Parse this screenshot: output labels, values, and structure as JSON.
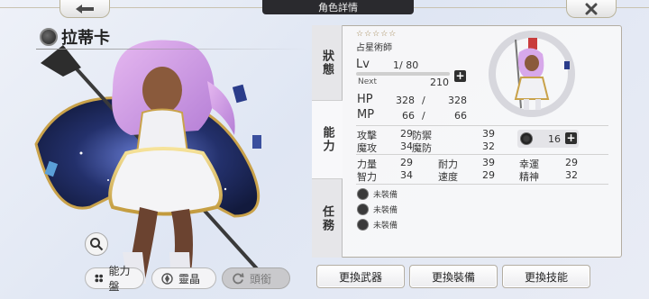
{
  "header": {
    "title": "角色詳情",
    "back_icon": "arrow-left-icon",
    "close_icon": "close-icon"
  },
  "character": {
    "name": "拉蒂卡",
    "element_icon": "dark-element-icon",
    "rarity_stars": "☆☆☆☆☆",
    "job": "占星術師"
  },
  "tabs": {
    "status": "狀態",
    "ability": "能力",
    "mission": "任務"
  },
  "level": {
    "label": "Lv",
    "value": "1/ 80",
    "next_label": "Next",
    "next_value": "210",
    "progress": 0.0
  },
  "vitals": {
    "hp_label": "HP",
    "hp_current": "328",
    "hp_max": "328",
    "mp_label": "MP",
    "mp_current": "66",
    "mp_max": "66",
    "separator": "/"
  },
  "stats": {
    "atk_label": "攻擊",
    "atk": "29",
    "def_label": "防禦",
    "def": "39",
    "matk_label": "魔攻",
    "matk": "34",
    "mdef_label": "魔防",
    "mdef": "32",
    "str_label": "力量",
    "str": "29",
    "vit_label": "耐力",
    "vit": "39",
    "luk_label": "幸運",
    "luk": "29",
    "int_label": "智力",
    "int": "34",
    "spd_label": "速度",
    "spd": "29",
    "spi_label": "精神",
    "spi": "32"
  },
  "gem": {
    "value": "16"
  },
  "equipment": {
    "slot1": "未裝備",
    "slot2": "未裝備",
    "slot3": "未裝備"
  },
  "left_buttons": {
    "ability_board": "能力盤",
    "crystal": "靈晶",
    "title": "頭銜"
  },
  "actions": {
    "change_weapon": "更換武器",
    "change_equipment": "更換裝備",
    "change_skill": "更換技能"
  },
  "colors": {
    "accent_gold": "#a08552",
    "panel_border": "#b3ada2",
    "header_dark": "#2a2a2e"
  }
}
